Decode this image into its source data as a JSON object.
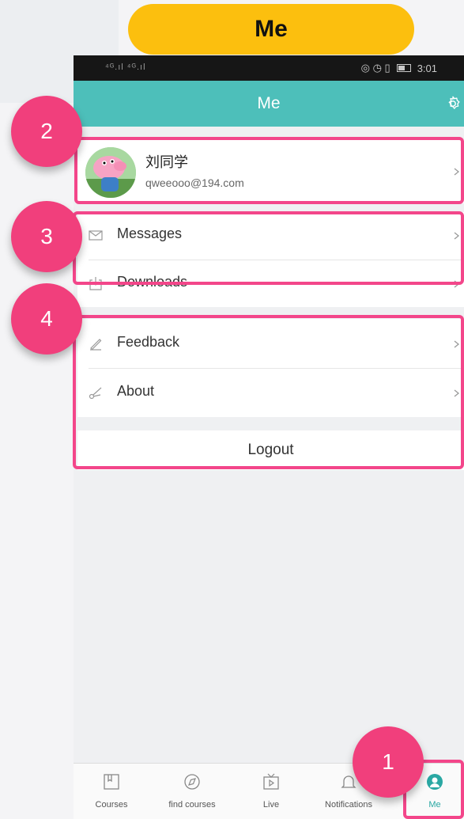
{
  "header": {
    "title": "Me"
  },
  "status_bar": {
    "signal": "⁴ᴳ.ıl ⁴ᴳ.ıl",
    "time": "3:01"
  },
  "app_bar": {
    "title": "Me",
    "settings_icon": "gear-icon"
  },
  "profile": {
    "name": "刘同学",
    "email": "qweeooo@194.com"
  },
  "menu_group_1": {
    "items": [
      {
        "label": "Messages",
        "icon": "envelope-icon"
      },
      {
        "label": "Downloads",
        "icon": "download-icon"
      }
    ]
  },
  "menu_group_2": {
    "items": [
      {
        "label": "Feedback",
        "icon": "pen-icon"
      },
      {
        "label": "About",
        "icon": "scissors-icon"
      }
    ]
  },
  "logout_label": "Logout",
  "callouts": [
    "1",
    "2",
    "3",
    "4"
  ],
  "tabs": [
    {
      "label": "Courses",
      "icon": "book-icon"
    },
    {
      "label": "find courses",
      "icon": "compass-icon"
    },
    {
      "label": "Live",
      "icon": "tv-play-icon"
    },
    {
      "label": "Notifications",
      "icon": "bell-icon"
    },
    {
      "label": "Me",
      "icon": "person-icon",
      "active": true
    }
  ],
  "colors": {
    "accent": "#4dbfba",
    "highlight": "#f3468a",
    "badge": "#f13f7c",
    "title_pill": "#fcbf0e"
  }
}
